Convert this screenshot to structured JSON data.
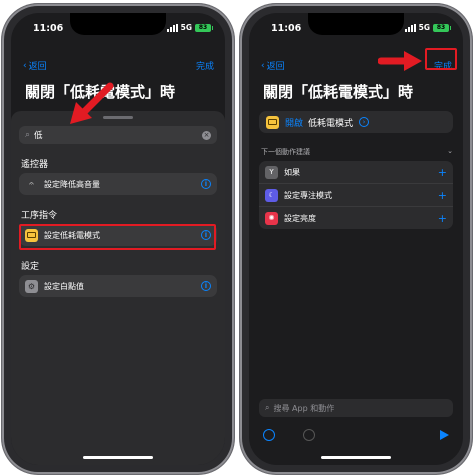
{
  "status": {
    "time": "11:06",
    "network": "5G",
    "battery": "83"
  },
  "left": {
    "back_label": "返回",
    "done_label": "完成",
    "title": "關閉「低耗電模式」時",
    "search": {
      "value": "低"
    },
    "sections": [
      {
        "label": "遙控器",
        "items": [
          {
            "label": "設定降低高音量",
            "icon": "hearing-icon"
          }
        ]
      },
      {
        "label": "工序指令",
        "items": [
          {
            "label": "設定低耗電模式",
            "icon": "battery-icon"
          }
        ]
      },
      {
        "label": "設定",
        "items": [
          {
            "label": "設定白點值",
            "icon": "settings-icon"
          }
        ]
      }
    ]
  },
  "right": {
    "back_label": "返回",
    "done_label": "完成",
    "title": "關閉「低耗電模式」時",
    "action": {
      "verb": "開啟",
      "object": "低耗電模式"
    },
    "suggestions_header": "下一個動作建議",
    "suggestions": [
      {
        "label": "如果",
        "icon": "if-icon"
      },
      {
        "label": "設定專注模式",
        "icon": "moon-icon"
      },
      {
        "label": "設定亮度",
        "icon": "brightness-icon"
      }
    ],
    "search_placeholder": "搜尋 App 和動作"
  },
  "colors": {
    "accent": "#0a84ff",
    "highlight": "#e21b23",
    "battery_yellow": "#f6c33d"
  }
}
